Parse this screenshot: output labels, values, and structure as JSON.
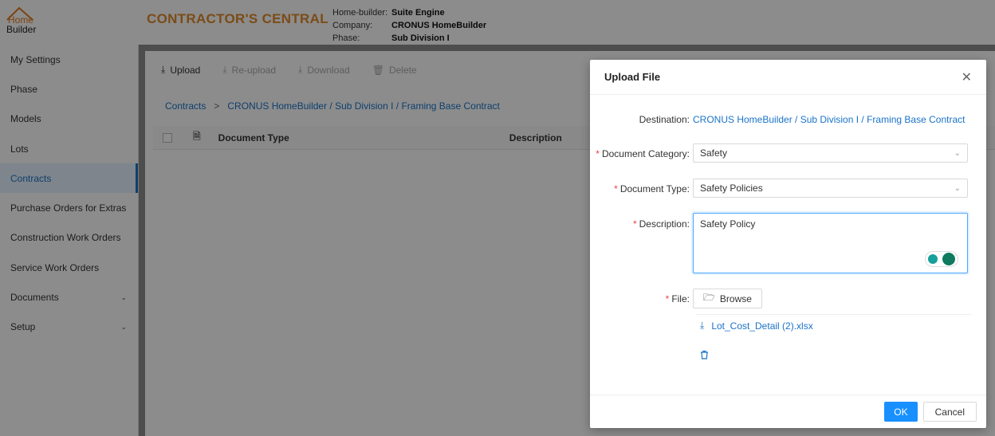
{
  "logo": {
    "line1": "Home",
    "line2": "Builder"
  },
  "app_title": "CONTRACTOR'S CENTRAL",
  "info": [
    {
      "label": "Home-builder:",
      "value": "Suite Engine"
    },
    {
      "label": "Company:",
      "value": "CRONUS HomeBuilder"
    },
    {
      "label": "Phase:",
      "value": "Sub Division I"
    }
  ],
  "sidebar": {
    "items": [
      {
        "label": "My Settings"
      },
      {
        "label": "Phase"
      },
      {
        "label": "Models"
      },
      {
        "label": "Lots"
      },
      {
        "label": "Contracts",
        "active": true
      },
      {
        "label": "Purchase Orders for Extras"
      },
      {
        "label": "Construction Work Orders"
      },
      {
        "label": "Service Work Orders"
      },
      {
        "label": "Documents",
        "expandable": true
      },
      {
        "label": "Setup",
        "expandable": true
      }
    ]
  },
  "toolbar": {
    "upload": "Upload",
    "reupload": "Re-upload",
    "download": "Download",
    "delete": "Delete"
  },
  "breadcrumb": {
    "root": "Contracts",
    "sep": ">",
    "path": "CRONUS HomeBuilder / Sub Division I / Framing Base Contract"
  },
  "table": {
    "col_type": "Document Type",
    "col_desc": "Description"
  },
  "modal": {
    "title": "Upload File",
    "destination_label": "Destination",
    "destination_value": "CRONUS HomeBuilder / Sub Division I / Framing Base Contract",
    "category_label": "Document Category",
    "category_value": "Safety",
    "type_label": "Document Type",
    "type_value": "Safety Policies",
    "description_label": "Description",
    "description_value": "Safety Policy",
    "file_label": "File",
    "browse_label": "Browse",
    "file_name": "Lot_Cost_Detail (2).xlsx",
    "ok_label": "OK",
    "cancel_label": "Cancel"
  }
}
